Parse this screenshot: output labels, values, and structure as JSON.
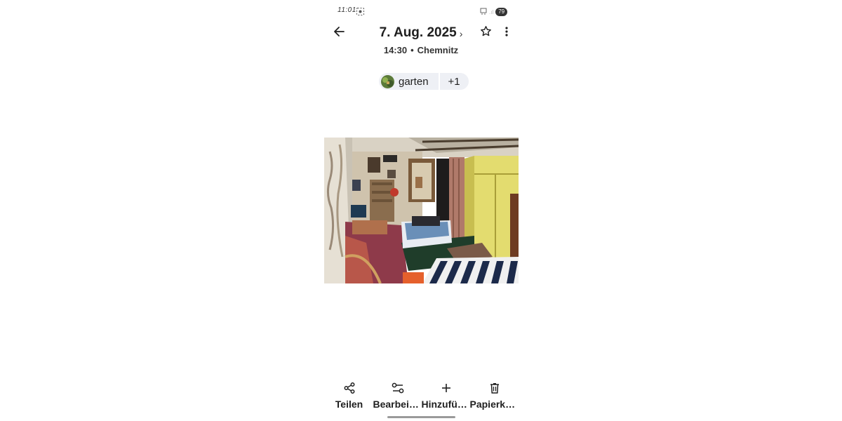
{
  "status_bar": {
    "time": "11:01",
    "battery": "79",
    "icons": [
      "screenshot-icon",
      "notification-icon",
      "signal-icon",
      "battery-icon"
    ]
  },
  "header": {
    "title": "7. Aug. 2025",
    "title_chevron": "›",
    "time": "14:30",
    "separator": "•",
    "location": "Chemnitz",
    "icons": [
      "back-arrow-icon",
      "star-icon",
      "more-vert-icon"
    ]
  },
  "chips": {
    "person_label": "garten",
    "more_label": "+1"
  },
  "actions": [
    {
      "label": "Teilen",
      "icon": "share-icon"
    },
    {
      "label": "Bearbeiten",
      "icon": "edit-tune-icon"
    },
    {
      "label": "Hinzufüg...",
      "icon": "add-icon"
    },
    {
      "label": "Papierkorb",
      "icon": "trash-icon"
    }
  ],
  "colors": {
    "chip_bg": "#eef0f5",
    "text": "#1f1f1f",
    "background": "#ffffff"
  }
}
